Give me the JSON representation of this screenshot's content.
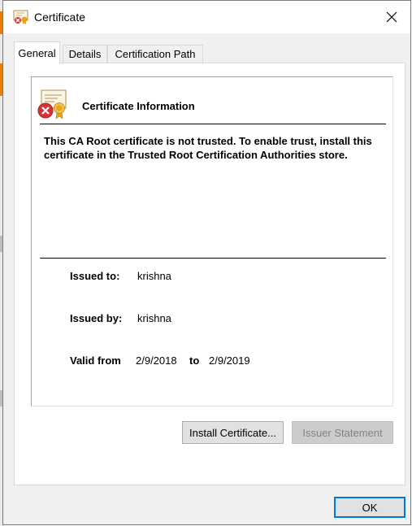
{
  "window": {
    "title": "Certificate"
  },
  "tabs": [
    {
      "label": "General",
      "active": true
    },
    {
      "label": "Details",
      "active": false
    },
    {
      "label": "Certification Path",
      "active": false
    }
  ],
  "info": {
    "heading": "Certificate Information",
    "warning": "This CA Root certificate is not trusted. To enable trust, install this certificate in the Trusted Root Certification Authorities store.",
    "issued_to_label": "Issued to:",
    "issued_to": "krishna",
    "issued_by_label": "Issued by:",
    "issued_by": "krishna",
    "valid_from_label": "Valid from",
    "valid_from": "2/9/2018",
    "valid_to_label": "to",
    "valid_to": "2/9/2019"
  },
  "buttons": {
    "install": "Install Certificate...",
    "issuer_statement": "Issuer Statement",
    "ok": "OK"
  },
  "colors": {
    "accent": "#0078d7",
    "error_red": "#d13438",
    "seal_gold": "#e8a317"
  }
}
